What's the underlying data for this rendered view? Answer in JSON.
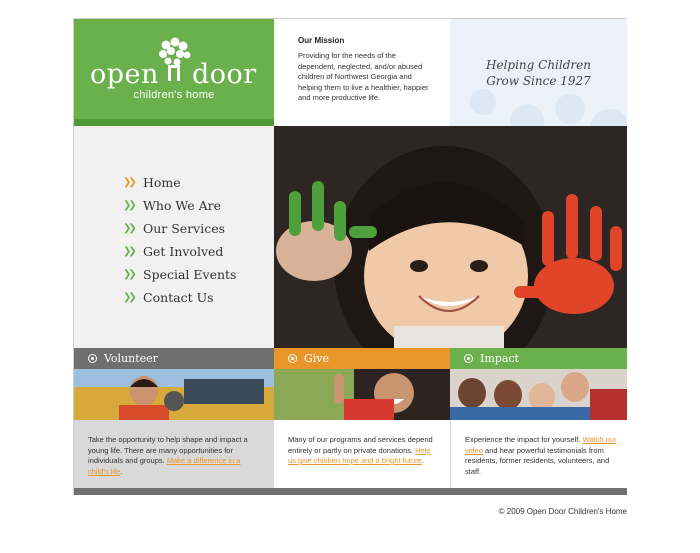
{
  "logo": {
    "word_open": "open",
    "word_door": "door",
    "subtitle": "children's home"
  },
  "mission": {
    "heading": "Our Mission",
    "text": "Providing for the needs of the dependent, neglected, and/or abused children of Northwest Georgia and helping them to live a healthier, happier and more productive life."
  },
  "tagline": {
    "line1": "Helping Children",
    "line2": "Grow Since 1927"
  },
  "nav": {
    "items": [
      {
        "label": "Home"
      },
      {
        "label": "Who We Are"
      },
      {
        "label": "Our Services"
      },
      {
        "label": "Get Involved"
      },
      {
        "label": "Special Events"
      },
      {
        "label": "Contact Us"
      }
    ]
  },
  "tabs": {
    "volunteer": "Volunteer",
    "give": "Give",
    "impact": "Impact"
  },
  "blurbs": {
    "volunteer_text": "Take the opportunity to help shape and impact a young life. There are many opportunities for individuals and groups.",
    "volunteer_link": "Make a difference in a child's life",
    "give_text": "Many of our programs and services depend entirely or partly on private donations.",
    "give_link": "Help us give children hope and a bright future",
    "impact_text1": "Experience the impact for yourself.",
    "impact_link": "Watch our video",
    "impact_text2": "and hear powerful testimonials from residents, former residents, volunteers, and staff."
  },
  "footer": {
    "copyright": "© 2009 Open Door Children's Home"
  },
  "colors": {
    "brand_green": "#6ab04c",
    "accent_orange": "#e8962a",
    "tab_gray": "#6f6f6f"
  }
}
